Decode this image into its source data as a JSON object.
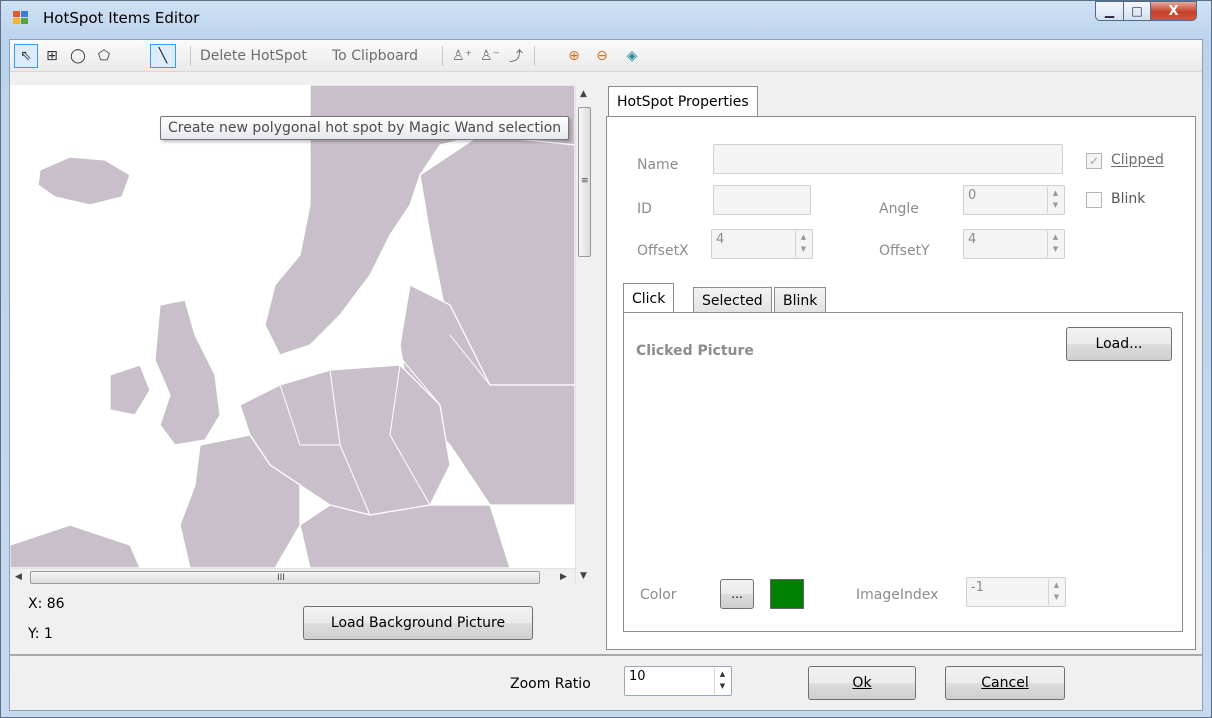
{
  "window": {
    "title": "HotSpot Items Editor",
    "minimize": "▁",
    "maximize": "□",
    "close": "X"
  },
  "toolbar": {
    "pointer": "⇖",
    "rect_tool": "⊞",
    "ellipse_tool": "◯",
    "polygon_tool": "⬠",
    "magic_wand": "╲",
    "delete_hotspot": "Delete HotSpot",
    "to_clipboard": "To Clipboard",
    "add_point": "♙⁺",
    "remove_point": "♙⁻",
    "edit_points": "⤴",
    "zoom_in": "⊕",
    "zoom_out": "⊖",
    "fit": "◈"
  },
  "map": {
    "tooltip": "Create new polygonal hot spot by Magic Wand selection",
    "scroll_up": "▲",
    "scroll_down": "▼",
    "scroll_left": "◀",
    "scroll_right": "▶",
    "grip_v": "≡",
    "grip_h": "III",
    "colors": {
      "land": "#c9bfca",
      "water": "#ffffff",
      "border": "#ffffff"
    }
  },
  "coords": {
    "x_label": "X:",
    "x_value": "86",
    "y_label": "Y:",
    "y_value": "1"
  },
  "load_background_button": "Load Background Picture",
  "properties": {
    "tab": "HotSpot Properties",
    "name_label": "Name",
    "name_value": "",
    "clipped_label": "Clipped",
    "clipped_checked": true,
    "blink_label": "Blink",
    "blink_checked": false,
    "id_label": "ID",
    "id_value": "",
    "angle_label": "Angle",
    "angle_value": "0",
    "offsetx_label": "OffsetX",
    "offsetx_value": "4",
    "offsety_label": "OffsetY",
    "offsety_value": "4",
    "subtabs": [
      "Click",
      "Selected",
      "Blink"
    ],
    "active_subtab": "Click",
    "clicked_picture_label": "Clicked Picture",
    "load_button": "Load...",
    "color_label": "Color",
    "color_button": "...",
    "color_value": "#008000",
    "imageindex_label": "ImageIndex",
    "imageindex_value": "-1"
  },
  "footer": {
    "zoom_label": "Zoom Ratio",
    "zoom_value": "10",
    "ok_button": "Ok",
    "cancel_button": "Cancel"
  }
}
